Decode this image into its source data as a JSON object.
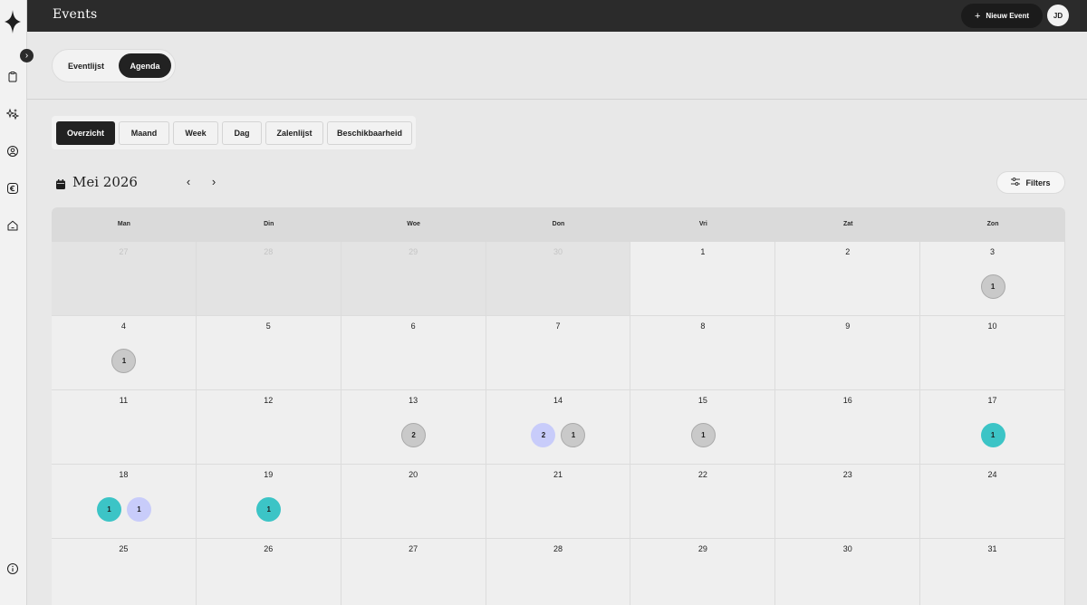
{
  "app": {
    "title": "Events"
  },
  "topbar": {
    "new_event_label": "Nieuw Event",
    "avatar_initials": "JD"
  },
  "sidebar": {
    "icons": [
      "clipboard-icon",
      "sparkles-icon",
      "user-circle-icon",
      "euro-icon",
      "home-icon",
      "info-icon"
    ]
  },
  "view_toggle": {
    "list_label": "Eventlijst",
    "agenda_label": "Agenda",
    "active": "Agenda"
  },
  "subtabs": {
    "active": "Overzicht",
    "items": [
      {
        "label": "Overzicht"
      },
      {
        "label": "Maand"
      },
      {
        "label": "Week"
      },
      {
        "label": "Dag"
      },
      {
        "label": "Zalenlijst"
      },
      {
        "label": "Beschikbaarheid"
      }
    ]
  },
  "calendar": {
    "month_label": "Mei 2026",
    "prev_label": "‹",
    "next_label": "›",
    "filters_label": "Filters",
    "weekdays": [
      "Man",
      "Din",
      "Woe",
      "Don",
      "Vri",
      "Zat",
      "Zon"
    ],
    "weeks": [
      [
        {
          "day": "27",
          "out": true,
          "events": []
        },
        {
          "day": "28",
          "out": true,
          "events": []
        },
        {
          "day": "29",
          "out": true,
          "events": []
        },
        {
          "day": "30",
          "out": true,
          "events": []
        },
        {
          "day": "1",
          "events": []
        },
        {
          "day": "2",
          "events": []
        },
        {
          "day": "3",
          "events": [
            {
              "count": "1",
              "color": "gray"
            }
          ]
        }
      ],
      [
        {
          "day": "4",
          "events": [
            {
              "count": "1",
              "color": "gray"
            }
          ]
        },
        {
          "day": "5",
          "events": []
        },
        {
          "day": "6",
          "events": []
        },
        {
          "day": "7",
          "events": []
        },
        {
          "day": "8",
          "events": []
        },
        {
          "day": "9",
          "events": []
        },
        {
          "day": "10",
          "events": []
        }
      ],
      [
        {
          "day": "11",
          "events": []
        },
        {
          "day": "12",
          "events": []
        },
        {
          "day": "13",
          "events": [
            {
              "count": "2",
              "color": "gray"
            }
          ]
        },
        {
          "day": "14",
          "events": [
            {
              "count": "2",
              "color": "lavender"
            },
            {
              "count": "1",
              "color": "gray"
            }
          ]
        },
        {
          "day": "15",
          "events": [
            {
              "count": "1",
              "color": "gray"
            }
          ]
        },
        {
          "day": "16",
          "events": []
        },
        {
          "day": "17",
          "events": [
            {
              "count": "1",
              "color": "teal"
            }
          ]
        }
      ],
      [
        {
          "day": "18",
          "events": [
            {
              "count": "1",
              "color": "teal"
            },
            {
              "count": "1",
              "color": "lavender"
            }
          ]
        },
        {
          "day": "19",
          "events": [
            {
              "count": "1",
              "color": "teal"
            }
          ]
        },
        {
          "day": "20",
          "events": []
        },
        {
          "day": "21",
          "events": []
        },
        {
          "day": "22",
          "events": []
        },
        {
          "day": "23",
          "events": []
        },
        {
          "day": "24",
          "events": []
        }
      ],
      [
        {
          "day": "25",
          "events": []
        },
        {
          "day": "26",
          "events": []
        },
        {
          "day": "27",
          "events": []
        },
        {
          "day": "28",
          "events": []
        },
        {
          "day": "29",
          "events": []
        },
        {
          "day": "30",
          "events": []
        },
        {
          "day": "31",
          "events": []
        }
      ]
    ]
  },
  "colors": {
    "gray": "#c9c9c9",
    "teal": "#3cc4c6",
    "lavender": "#c8ccfa",
    "dark": "#222222"
  }
}
